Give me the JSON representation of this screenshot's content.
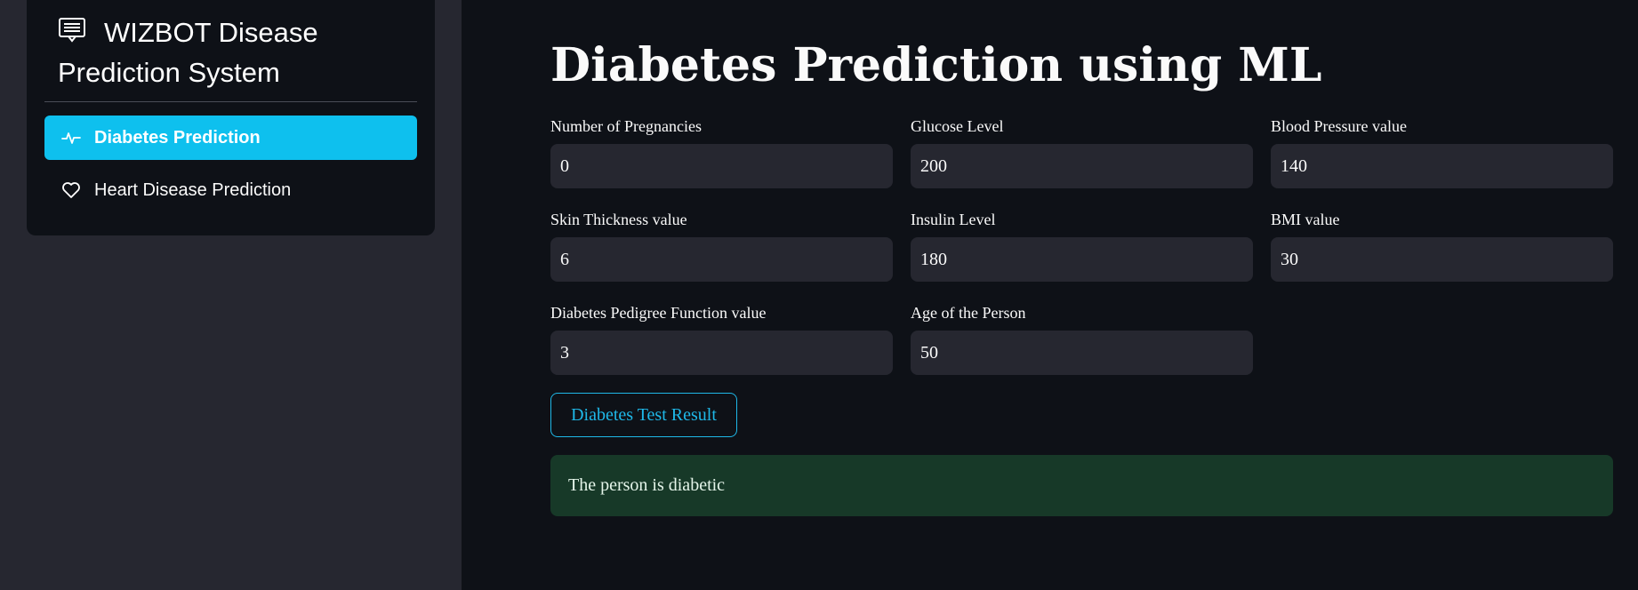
{
  "sidebar": {
    "title_icon": "chat-list-icon",
    "title": "WIZBOT Disease Prediction System",
    "items": [
      {
        "label": "Diabetes Prediction",
        "icon": "activity-icon",
        "active": true
      },
      {
        "label": "Heart Disease Prediction",
        "icon": "heart-icon",
        "active": false
      }
    ],
    "accent_color": "#0ec0ee"
  },
  "main": {
    "title": "Diabetes Prediction using ML",
    "fields": [
      {
        "label": "Number of Pregnancies",
        "value": "0"
      },
      {
        "label": "Glucose Level",
        "value": "200"
      },
      {
        "label": "Blood Pressure value",
        "value": "140"
      },
      {
        "label": "Skin Thickness value",
        "value": "6"
      },
      {
        "label": "Insulin Level",
        "value": "180"
      },
      {
        "label": "BMI value",
        "value": "30"
      },
      {
        "label": "Diabetes Pedigree Function value",
        "value": "3"
      },
      {
        "label": "Age of the Person",
        "value": "50"
      }
    ],
    "button_label": "Diabetes Test Result",
    "result": "The person is diabetic",
    "result_color": "#173928"
  }
}
